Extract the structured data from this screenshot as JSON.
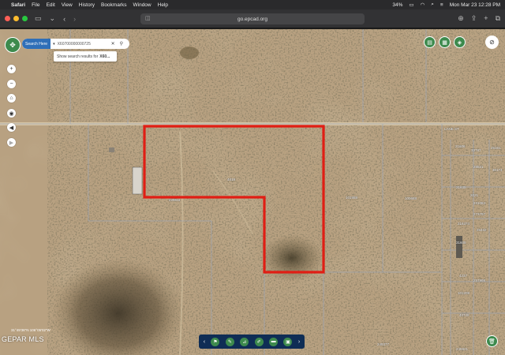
{
  "menubar": {
    "apple_icon": "apple-icon",
    "app": "Safari",
    "items": [
      "File",
      "Edit",
      "View",
      "History",
      "Bookmarks",
      "Window",
      "Help"
    ],
    "battery": "34%",
    "datetime": "Mon Mar 23  12:28 PM"
  },
  "browser": {
    "url": "go.epcad.org"
  },
  "search": {
    "label": "Search Here",
    "query": "X60700000000725",
    "suggestion_prefix": "Show search results for",
    "suggestion_bold": "X60..."
  },
  "map": {
    "coords": "31°49'36\"N 106°05'02\"W",
    "watermark": "GEPAR MLS",
    "parcel_labels": [
      {
        "text": "4619"
      },
      {
        "text": "229611"
      },
      {
        "text": "101988"
      },
      {
        "text": "100688"
      },
      {
        "text": "LANE ST"
      },
      {
        "text": "21606"
      },
      {
        "text": "33787"
      },
      {
        "text": "26151"
      },
      {
        "text": "28521"
      },
      {
        "text": "30174"
      },
      {
        "text": "21635"
      },
      {
        "text": "2021"
      },
      {
        "text": "231084"
      },
      {
        "text": "273797"
      },
      {
        "text": "216374"
      },
      {
        "text": "26432"
      },
      {
        "text": "31605"
      },
      {
        "text": "4237"
      },
      {
        "text": "257998"
      },
      {
        "text": "101208"
      },
      {
        "text": "40729"
      },
      {
        "text": "245921"
      },
      {
        "text": "249377"
      }
    ],
    "highlight_color": "#e01e14"
  },
  "colors": {
    "accent_green": "#3d8a4d",
    "search_blue": "#2f6fb8",
    "toolbar_navy": "#0f2d55"
  }
}
